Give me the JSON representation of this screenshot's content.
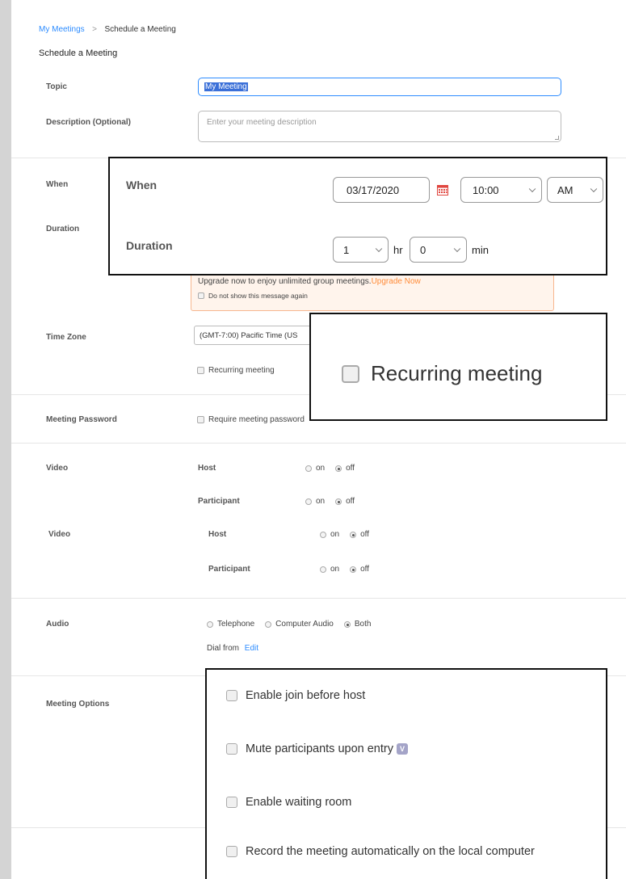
{
  "breadcrumb": {
    "link": "My Meetings",
    "separator": ">",
    "current": "Schedule a Meeting"
  },
  "page_title": "Schedule a Meeting",
  "topic": {
    "label": "Topic",
    "value": "My Meeting"
  },
  "description": {
    "label": "Description (Optional)",
    "placeholder": "Enter your meeting description"
  },
  "when": {
    "label": "When"
  },
  "duration": {
    "label": "Duration"
  },
  "upgrade": {
    "text": "Upgrade now to enjoy unlimited group meetings.",
    "link": "Upgrade Now",
    "dont_show": "Do not show this message again"
  },
  "timezone": {
    "label": "Time Zone",
    "value": "(GMT-7:00) Pacific Time (US"
  },
  "recurring": {
    "label": "Recurring meeting"
  },
  "password": {
    "label": "Meeting Password",
    "require": "Require meeting password"
  },
  "video1": {
    "label": "Video",
    "host": "Host",
    "participant": "Participant",
    "on": "on",
    "off": "off"
  },
  "video2": {
    "label": "Video",
    "host": "Host",
    "participant": "Participant",
    "on": "on",
    "off": "off"
  },
  "audio": {
    "label": "Audio",
    "telephone": "Telephone",
    "computer": "Computer Audio",
    "both": "Both",
    "dial_from": "Dial from",
    "edit": "Edit"
  },
  "meeting_options": {
    "label": "Meeting Options"
  },
  "callout_when": {
    "when_label": "When",
    "date": "03/17/2020",
    "time": "10:00",
    "ampm": "AM",
    "duration_label": "Duration",
    "hours": "1",
    "hr": "hr",
    "minutes": "0",
    "min": "min"
  },
  "callout_recurring": {
    "label": "Recurring meeting"
  },
  "callout_options": {
    "items": [
      "Enable join before host",
      "Mute participants upon entry",
      "Enable waiting room",
      "Record the meeting automatically on the local computer"
    ]
  },
  "colors": {
    "accent": "#2d8cff",
    "upgrade_bg": "#fff4ec",
    "upgrade_border": "#f7b78f",
    "upgrade_link": "#ff8c3a",
    "calendar": "#e0463f"
  }
}
